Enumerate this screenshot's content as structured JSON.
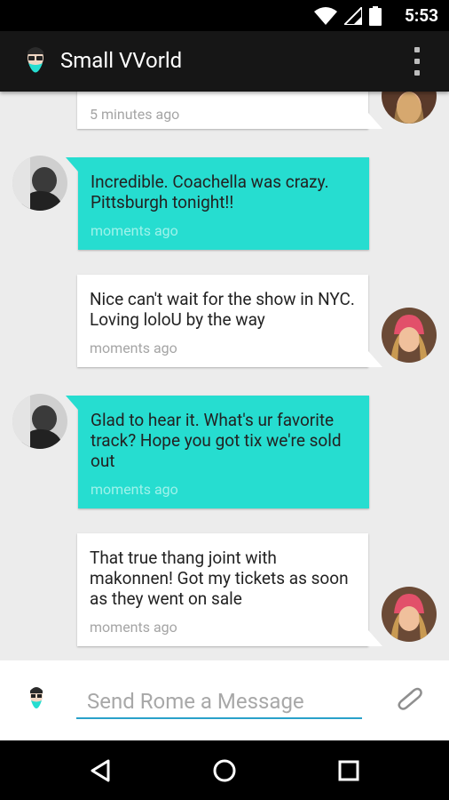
{
  "status_bar": {
    "time": "5:53"
  },
  "app_bar": {
    "title": "Small VVorld"
  },
  "messages": [
    {
      "direction": "out",
      "text": "",
      "time": "5 minutes ago"
    },
    {
      "direction": "in",
      "text": "Incredible. Coachella was crazy. Pittsburgh tonight!!",
      "time": "moments ago"
    },
    {
      "direction": "out",
      "text": "Nice can't wait for the show in NYC. Loving loloU by the way",
      "time": "moments ago"
    },
    {
      "direction": "in",
      "text": "Glad to hear it. What's ur favorite track? Hope you got tix we're sold out",
      "time": "moments ago"
    },
    {
      "direction": "out",
      "text": "That true thang  joint with makonnen! Got my tickets as soon as they went on sale",
      "time": "moments ago"
    }
  ],
  "compose": {
    "placeholder": "Send Rome a Message",
    "value": ""
  },
  "colors": {
    "accent": "#26ddd0",
    "app_bar": "#161616",
    "background": "#ececec",
    "input_line": "#2aa1c9"
  },
  "icons": [
    "wifi-icon",
    "signal-icon",
    "battery-icon",
    "overflow-menu-icon",
    "attach-icon",
    "back-icon",
    "home-icon",
    "recents-icon"
  ]
}
